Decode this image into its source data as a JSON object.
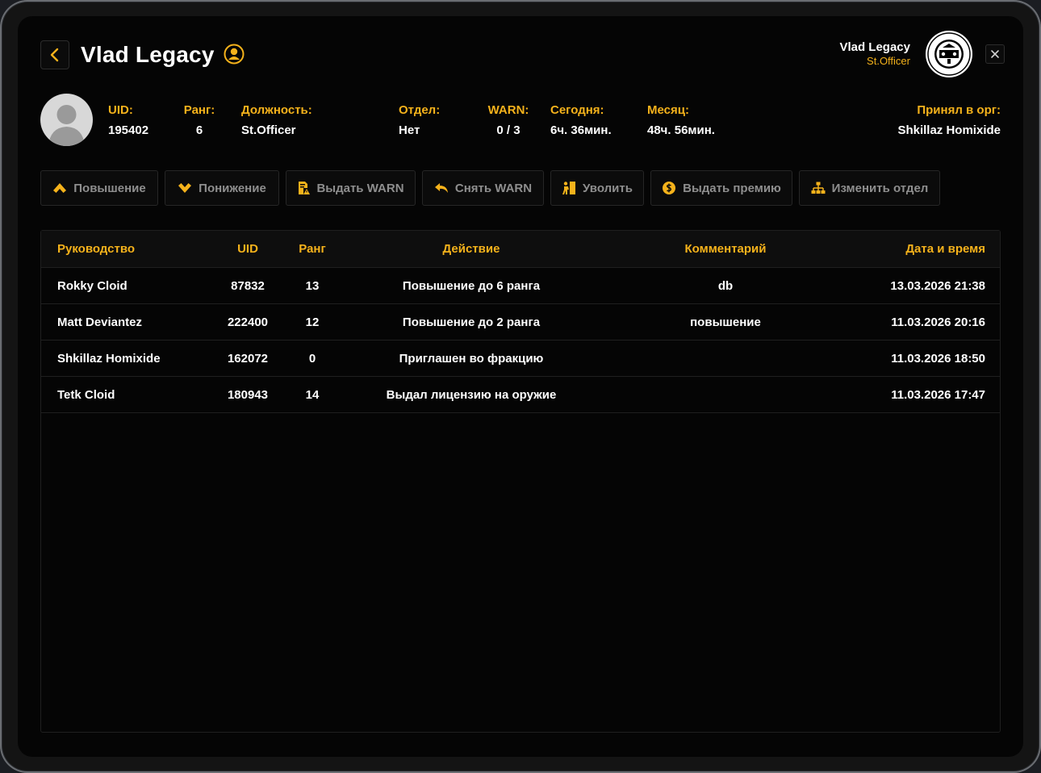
{
  "header": {
    "title": "Vlad Legacy",
    "badge_icon": "user-badge-icon",
    "current_user": {
      "name": "Vlad Legacy",
      "role": "St.Officer"
    },
    "org_seal": "city-seal-icon"
  },
  "profile": {
    "uid_label": "UID:",
    "uid": "195402",
    "rank_label": "Ранг:",
    "rank": "6",
    "position_label": "Должность:",
    "position": "St.Officer",
    "department_label": "Отдел:",
    "department": "Нет",
    "warn_label": "WARN:",
    "warn": "0 / 3",
    "today_label": "Сегодня:",
    "today": "6ч. 36мин.",
    "month_label": "Месяц:",
    "month": "48ч. 56мин.",
    "accepted_label": "Принял в орг:",
    "accepted_by": "Shkillaz Homixide"
  },
  "actions": [
    {
      "label": "Повышение",
      "icon": "chevron-up-icon"
    },
    {
      "label": "Понижение",
      "icon": "chevron-down-icon"
    },
    {
      "label": "Выдать WARN",
      "icon": "warn-document-icon"
    },
    {
      "label": "Снять WARN",
      "icon": "undo-arrow-icon"
    },
    {
      "label": "Уволить",
      "icon": "exit-person-icon"
    },
    {
      "label": "Выдать премию",
      "icon": "coin-icon"
    },
    {
      "label": "Изменить отдел",
      "icon": "hierarchy-icon"
    }
  ],
  "table": {
    "columns": [
      "Руководство",
      "UID",
      "Ранг",
      "Действие",
      "Комментарий",
      "Дата и время"
    ],
    "rows": [
      [
        "Rokky Cloid",
        "87832",
        "13",
        "Повышение до 6 ранга",
        "db",
        "13.03.2026 21:38"
      ],
      [
        "Matt Deviantez",
        "222400",
        "12",
        "Повышение до 2 ранга",
        "повышение",
        "11.03.2026 20:16"
      ],
      [
        "Shkillaz Homixide",
        "162072",
        "0",
        "Приглашен во фракцию",
        "",
        "11.03.2026 18:50"
      ],
      [
        "Tetk Cloid",
        "180943",
        "14",
        "Выдал лицензию на оружие",
        "",
        "11.03.2026 17:47"
      ]
    ]
  },
  "colors": {
    "accent": "#f5b21b",
    "background": "#050505",
    "muted": "#8e8e8e"
  }
}
